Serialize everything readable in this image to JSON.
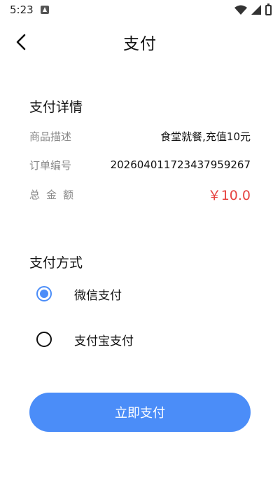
{
  "status_bar": {
    "time": "5:23"
  },
  "header": {
    "title": "支付"
  },
  "details": {
    "title": "支付详情",
    "product_label": "商品描述",
    "product_value": "食堂就餐,充值10元",
    "order_label": "订单编号",
    "order_value": "20260401172343795926​7",
    "total_label": "总金额",
    "total_value": "￥10.0"
  },
  "payment": {
    "title": "支付方式",
    "options": [
      {
        "label": "微信支付",
        "selected": true
      },
      {
        "label": "支付宝支付",
        "selected": false
      }
    ]
  },
  "actions": {
    "pay_label": "立即支付"
  },
  "colors": {
    "accent": "#4b8df8",
    "amount": "#e64340"
  }
}
